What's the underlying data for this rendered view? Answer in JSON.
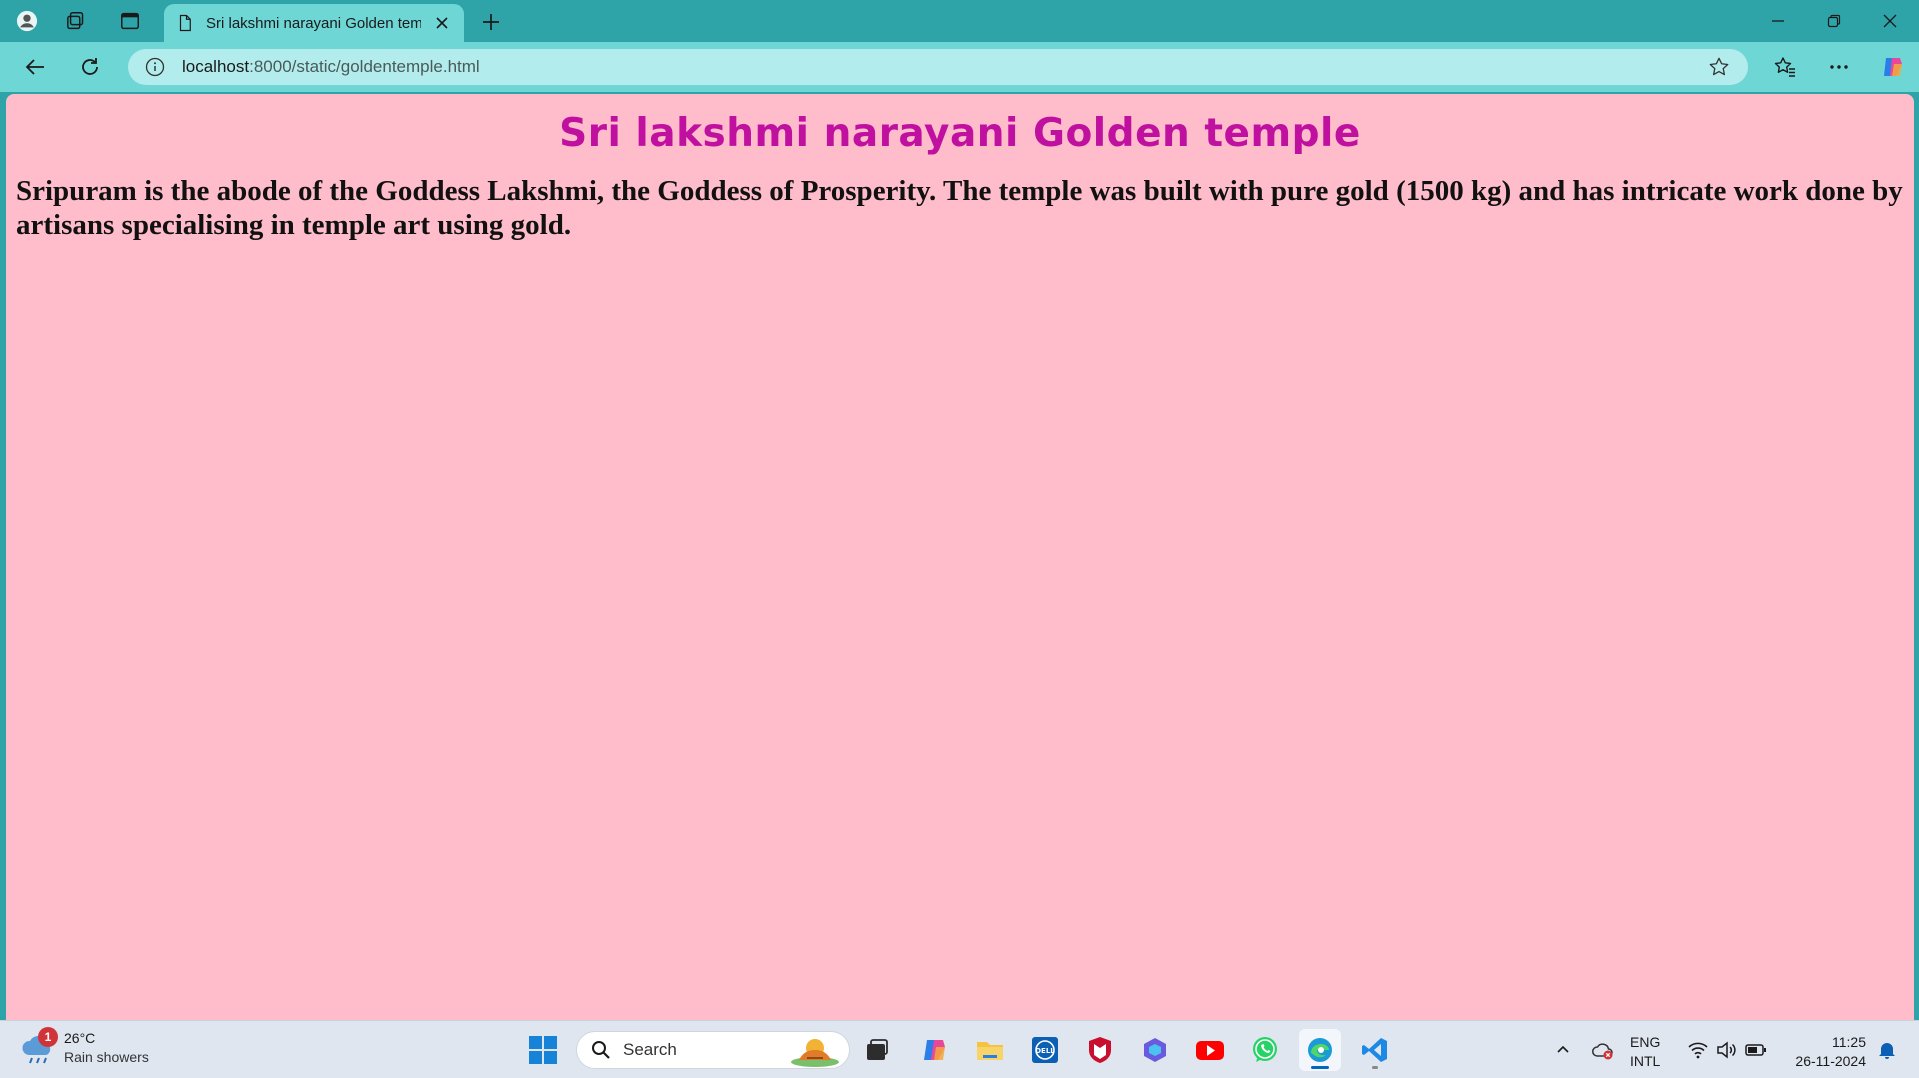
{
  "browser": {
    "tab": {
      "title": "Sri lakshmi narayani Golden temp",
      "icon": "page-icon"
    },
    "address": {
      "host": "localhost",
      "rest": ":8000/static/goldentemple.html"
    }
  },
  "page": {
    "title": "Sri lakshmi narayani Golden temple",
    "paragraph": "Sripuram is the abode of the Goddess Lakshmi, the Goddess of Prosperity. The temple was built with pure gold (1500 kg) and has intricate work done by artisans specialising in temple art using gold.",
    "background_color": "#ffbccb",
    "title_color": "#c010a0"
  },
  "taskbar": {
    "weather": {
      "badge": "1",
      "temp": "26°C",
      "condition": "Rain showers"
    },
    "search": {
      "label": "Search"
    },
    "language": {
      "line1": "ENG",
      "line2": "INTL"
    },
    "clock": {
      "time": "11:25",
      "date": "26-11-2024"
    }
  },
  "colors": {
    "titlebar": "#2ea3a8",
    "toolbar": "#6fd6d6",
    "omnibox": "#b2ecec",
    "taskbar": "#dfe6f0"
  }
}
